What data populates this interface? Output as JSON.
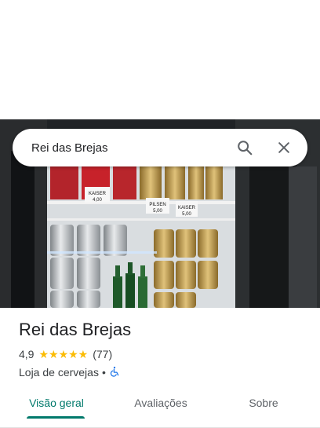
{
  "search": {
    "query": "Rei das Brejas",
    "search_icon": "search-icon",
    "close_icon": "close-icon"
  },
  "photo": {
    "price_tags": [
      "KAISER",
      "4,00",
      "PILSEN",
      "5,00",
      "KAISER",
      "5,00"
    ]
  },
  "place": {
    "name": "Rei das Brejas",
    "rating": "4,9",
    "stars": "★★★★★",
    "reviews": "(77)",
    "category": "Loja de cervejas",
    "separator": "•",
    "accessibility_icon": "wheelchair-icon"
  },
  "tabs": [
    {
      "label": "Visão geral",
      "active": true
    },
    {
      "label": "Avaliações",
      "active": false
    },
    {
      "label": "Sobre",
      "active": false
    }
  ],
  "colors": {
    "accent": "#00796b",
    "star": "#fbbc04",
    "accessibility": "#1a73e8"
  }
}
